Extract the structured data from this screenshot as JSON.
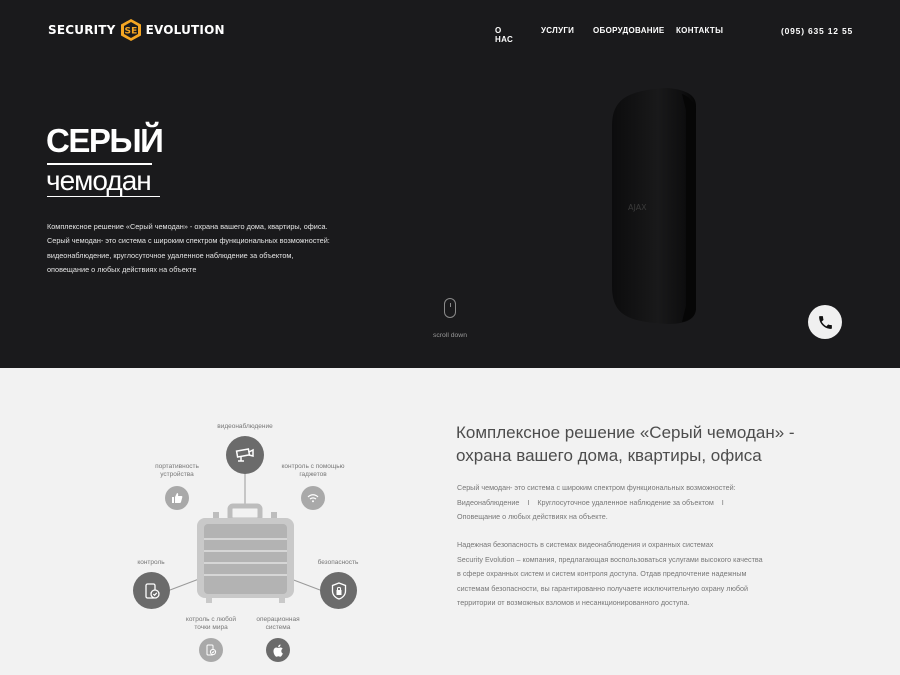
{
  "header": {
    "logo_left": "SECURITY",
    "logo_right": "EVOLUTION",
    "logo_mark": "SE",
    "nav": [
      "О НАС",
      "УСЛУГИ",
      "ОБОРУДОВАНИЕ",
      "КОНТАКТЫ"
    ],
    "phone": "(095) 635 12 55"
  },
  "hero": {
    "title_line1": "СЕРЫЙ",
    "title_line2": "чемодан",
    "description_lines": [
      "Комплексное решение «Серый чемодан» - охрана вашего дома, квартиры, офиса.",
      "Серый чемодан- это система с широким спектром функциональных возможностей:",
      "видеонаблюдение, круглосуточное удаленное наблюдение за объектом,",
      "оповещание о любых действиях на объекте"
    ],
    "device_brand": "AJAX",
    "scroll_label": "scroll down"
  },
  "diagram": {
    "labels": {
      "video": "видеонаблюдение",
      "portable": "портативность устройства",
      "gadgets": "контроль с помощью гаджетов",
      "control": "контроль",
      "security": "безопасность",
      "anywhere": "котроль с любой точки мира",
      "os": "операционная система"
    }
  },
  "section": {
    "title": "Комплексное решение «Серый чемодан» - охрана вашего дома, квартиры, офиса",
    "para1_line1": "Серый чемодан- это система с широким спектром функциональных возможностей:",
    "para1_items": [
      "Видеонаблюдение",
      "Круглосуточное удаленное наблюдение за объектом"
    ],
    "para1_sep": "I",
    "para1_line3": "Оповещание о любых действиях на объекте.",
    "para2_lines": [
      "Надежная безопасность в системах видеонаблюдения и охранных системах",
      "Security Evolution – компания, предлагающая воспользоваться услугами высокого качества",
      "в сфере охранных систем и систем контроля доступа. Отдав предпочтение надежным",
      "системам безопасности, вы гарантированно получаете исключительную охрану любой",
      "территории от возможных взломов и несанкционированного доступа."
    ]
  },
  "colors": {
    "hero_bg": "#1a1a1c",
    "page_bg": "#f2f2f2",
    "accent_logo": "#f5a623",
    "icon_dark": "#6b6b6b",
    "icon_light": "#a9a9a9"
  }
}
